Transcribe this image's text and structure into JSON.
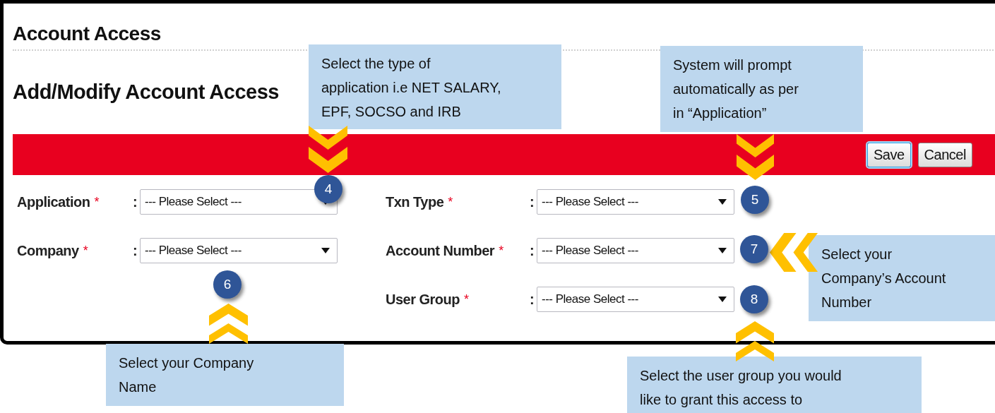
{
  "page": {
    "title": "Account Access",
    "subtitle": "Add/Modify Account Access"
  },
  "buttons": [
    {
      "label": "Save",
      "focused": true
    },
    {
      "label": "Cancel",
      "focused": false
    }
  ],
  "fields": [
    {
      "label": "Application",
      "required_mark": "*",
      "separator": ":",
      "value": "--- Please Select ---"
    },
    {
      "label": "Txn Type",
      "required_mark": "*",
      "separator": ":",
      "value": "--- Please Select ---"
    },
    {
      "label": "Company",
      "required_mark": "*",
      "separator": ":",
      "value": "--- Please Select ---"
    },
    {
      "label": "Account Number",
      "required_mark": "*",
      "separator": ":",
      "value": "--- Please Select ---"
    },
    {
      "label": "User Group",
      "required_mark": "*",
      "separator": ":",
      "value": "--- Please Select ---"
    }
  ],
  "annotations": [
    {
      "number": "4",
      "kind": "down",
      "lines": [
        "Select the type of",
        "application i.e NET SALARY,",
        "EPF, SOCSO and IRB"
      ]
    },
    {
      "number": "5",
      "kind": "down",
      "lines": [
        "System will prompt",
        "automatically as per",
        "in “Application”"
      ]
    },
    {
      "number": "6",
      "kind": "up",
      "lines": [
        "Select your Company",
        "Name"
      ]
    },
    {
      "number": "7",
      "kind": "left",
      "lines": [
        "Select your",
        "Company’s Account",
        "Number"
      ]
    },
    {
      "number": "8",
      "kind": "up",
      "lines": [
        "Select the user group you would",
        "like to grant this access to"
      ]
    }
  ]
}
